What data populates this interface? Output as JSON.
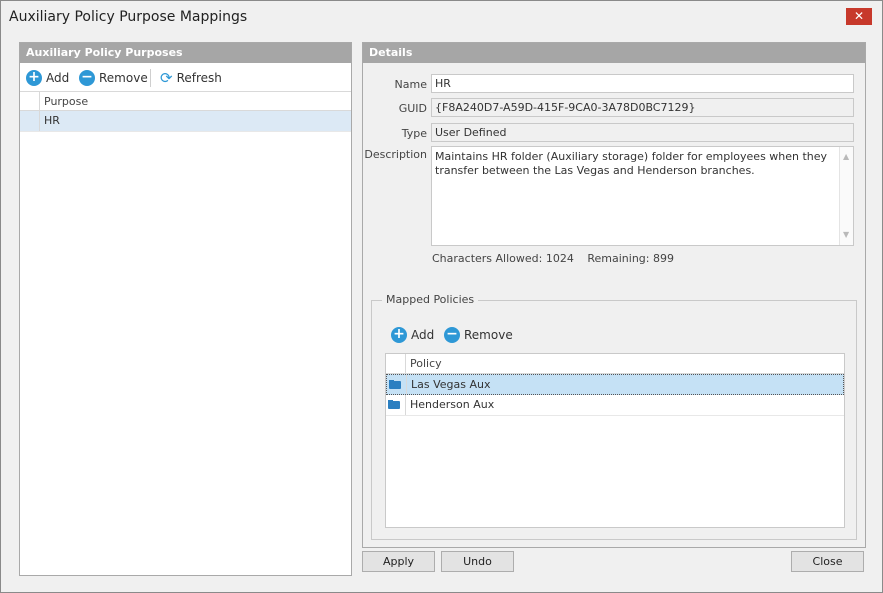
{
  "window": {
    "title": "Auxiliary Policy Purpose Mappings",
    "close_glyph": "✕"
  },
  "left": {
    "header": "Auxiliary Policy Purposes",
    "toolbar": {
      "add": "Add",
      "remove": "Remove",
      "refresh": "Refresh"
    },
    "columns": [
      "Purpose"
    ],
    "rows": [
      {
        "purpose": "HR"
      }
    ]
  },
  "details": {
    "header": "Details",
    "name_label": "Name",
    "name_value": "HR",
    "guid_label": "GUID",
    "guid_value": "{F8A240D7-A59D-415F-9CA0-3A78D0BC7129}",
    "type_label": "Type",
    "type_value": "User Defined",
    "description_label": "Description",
    "description_value": "Maintains HR folder (Auxiliary storage) folder for employees when they transfer between the Las Vegas and Henderson branches.",
    "chars_allowed_label": "Characters Allowed:",
    "chars_allowed_value": "1024",
    "remaining_label": "Remaining:",
    "remaining_value": "899"
  },
  "mapped": {
    "legend": "Mapped Policies",
    "toolbar": {
      "add": "Add",
      "remove": "Remove"
    },
    "columns": [
      "Policy"
    ],
    "rows": [
      {
        "policy": "Las Vegas Aux"
      },
      {
        "policy": "Henderson Aux"
      }
    ]
  },
  "buttons": {
    "apply": "Apply",
    "undo": "Undo",
    "close": "Close"
  },
  "colors": {
    "accent": "#2e98d6",
    "header_gray": "#a6a6a6",
    "selected_row": "#dce9f5",
    "close_red": "#c7392b"
  }
}
